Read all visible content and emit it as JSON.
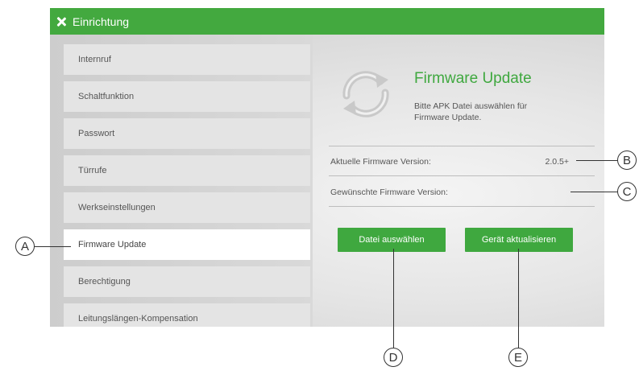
{
  "titlebar": {
    "title": "Einrichtung"
  },
  "sidebar": {
    "items": [
      {
        "label": "Internruf"
      },
      {
        "label": "Schaltfunktion"
      },
      {
        "label": "Passwort"
      },
      {
        "label": "Türrufe"
      },
      {
        "label": "Werkseinstellungen"
      },
      {
        "label": "Firmware Update",
        "active": true
      },
      {
        "label": "Berechtigung"
      },
      {
        "label": "Leitungslängen-Kompensation"
      }
    ]
  },
  "panel": {
    "icon": "refresh-icon",
    "title": "Firmware Update",
    "description": "Bitte APK Datei auswählen für Firmware Update.",
    "current_label": "Aktuelle Firmware Version:",
    "current_value": "2.0.5+",
    "desired_label": "Gewünschte Firmware Version:",
    "desired_value": "",
    "select_button": "Datei auswählen",
    "update_button": "Gerät aktualisieren"
  },
  "callouts": {
    "a": "A",
    "b": "B",
    "c": "C",
    "d": "D",
    "e": "E"
  },
  "colors": {
    "accent": "#43a93f",
    "title_green": "#3fa83f"
  }
}
